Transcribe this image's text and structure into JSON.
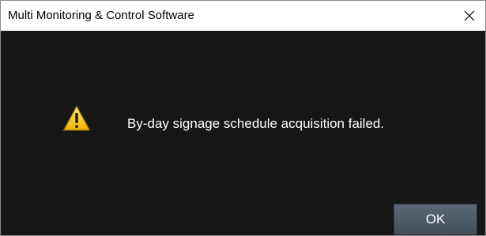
{
  "window": {
    "title": "Multi Monitoring & Control Software"
  },
  "dialog": {
    "icon": "warning-icon",
    "message": "By-day signage schedule acquisition failed.",
    "ok_label": "OK"
  },
  "colors": {
    "background": "#161616",
    "titlebar": "#ffffff",
    "text": "#ffffff",
    "warning_yellow": "#f5c518",
    "button": "#4f5a67"
  }
}
